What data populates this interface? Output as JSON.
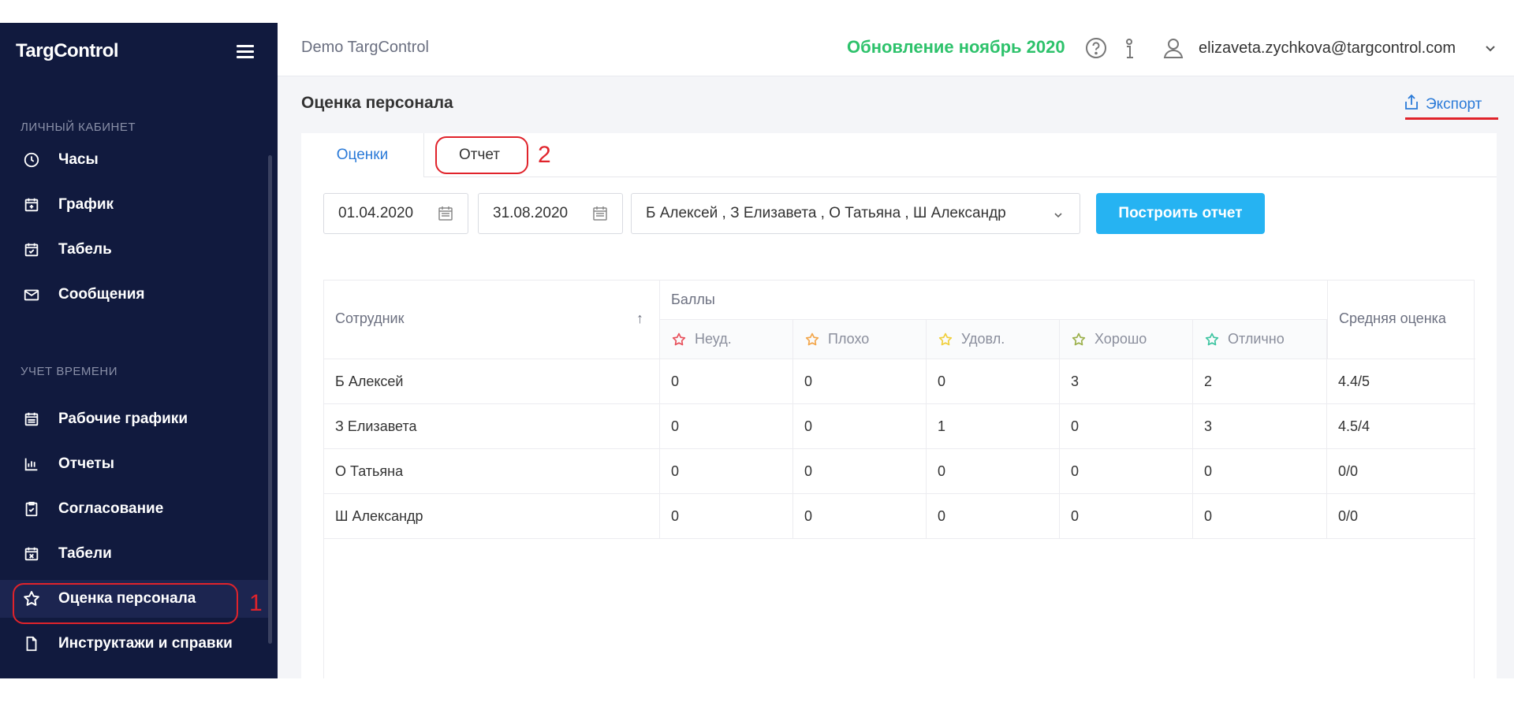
{
  "sidebar": {
    "logo": "TargControl",
    "section1": "ЛИЧНЫЙ КАБИНЕТ",
    "section2": "УЧЕТ ВРЕМЕНИ",
    "items": [
      {
        "label": "Часы",
        "icon": "clock-icon"
      },
      {
        "label": "График",
        "icon": "calendar-plus-icon"
      },
      {
        "label": "Табель",
        "icon": "calendar-check-icon"
      },
      {
        "label": "Сообщения",
        "icon": "mail-icon"
      },
      {
        "label": "Рабочие графики",
        "icon": "calendar-grid-icon"
      },
      {
        "label": "Отчеты",
        "icon": "bar-chart-icon"
      },
      {
        "label": "Согласование",
        "icon": "clipboard-check-icon"
      },
      {
        "label": "Табели",
        "icon": "calendar-x-icon"
      },
      {
        "label": "Оценка персонала",
        "icon": "star-icon",
        "active": true
      },
      {
        "label": "Инструктажи и справки",
        "icon": "document-icon"
      }
    ]
  },
  "topbar": {
    "title": "Demo TargControl",
    "update_link": "Обновление ноябрь 2020",
    "user_email": "elizaveta.zychkova@targcontrol.com"
  },
  "page": {
    "title": "Оценка персонала",
    "export_label": "Экспорт"
  },
  "tabs": [
    "Оценки",
    "Отчет"
  ],
  "filters": {
    "date_from": "01.04.2020",
    "date_to": "31.08.2020",
    "employees": "Б Алексей , З Елизавета , О Татьяна , Ш Александр",
    "build_button": "Построить отчет"
  },
  "table": {
    "col_employee": "Сотрудник",
    "col_group": "Баллы",
    "col_avg": "Средняя оценка",
    "score_columns": [
      {
        "label": "Неуд.",
        "color": "#e8505b"
      },
      {
        "label": "Плохо",
        "color": "#f3a64a"
      },
      {
        "label": "Удовл.",
        "color": "#f0cf3c"
      },
      {
        "label": "Хорошо",
        "color": "#9bb04a"
      },
      {
        "label": "Отлично",
        "color": "#3cc4a0"
      }
    ],
    "rows": [
      {
        "name": "Б Алексей",
        "scores": [
          "0",
          "0",
          "0",
          "3",
          "2"
        ],
        "avg": "4.4/5"
      },
      {
        "name": "З Елизавета",
        "scores": [
          "0",
          "0",
          "1",
          "0",
          "3"
        ],
        "avg": "4.5/4"
      },
      {
        "name": "О Татьяна",
        "scores": [
          "0",
          "0",
          "0",
          "0",
          "0"
        ],
        "avg": "0/0"
      },
      {
        "name": "Ш Александр",
        "scores": [
          "0",
          "0",
          "0",
          "0",
          "0"
        ],
        "avg": "0/0"
      }
    ]
  },
  "annotations": [
    "1",
    "2"
  ],
  "colors": {
    "sidebar_bg": "#111a3e",
    "accent_blue": "#26b3f2",
    "update_green": "#2dc26b",
    "annotation_red": "#e0232b"
  }
}
